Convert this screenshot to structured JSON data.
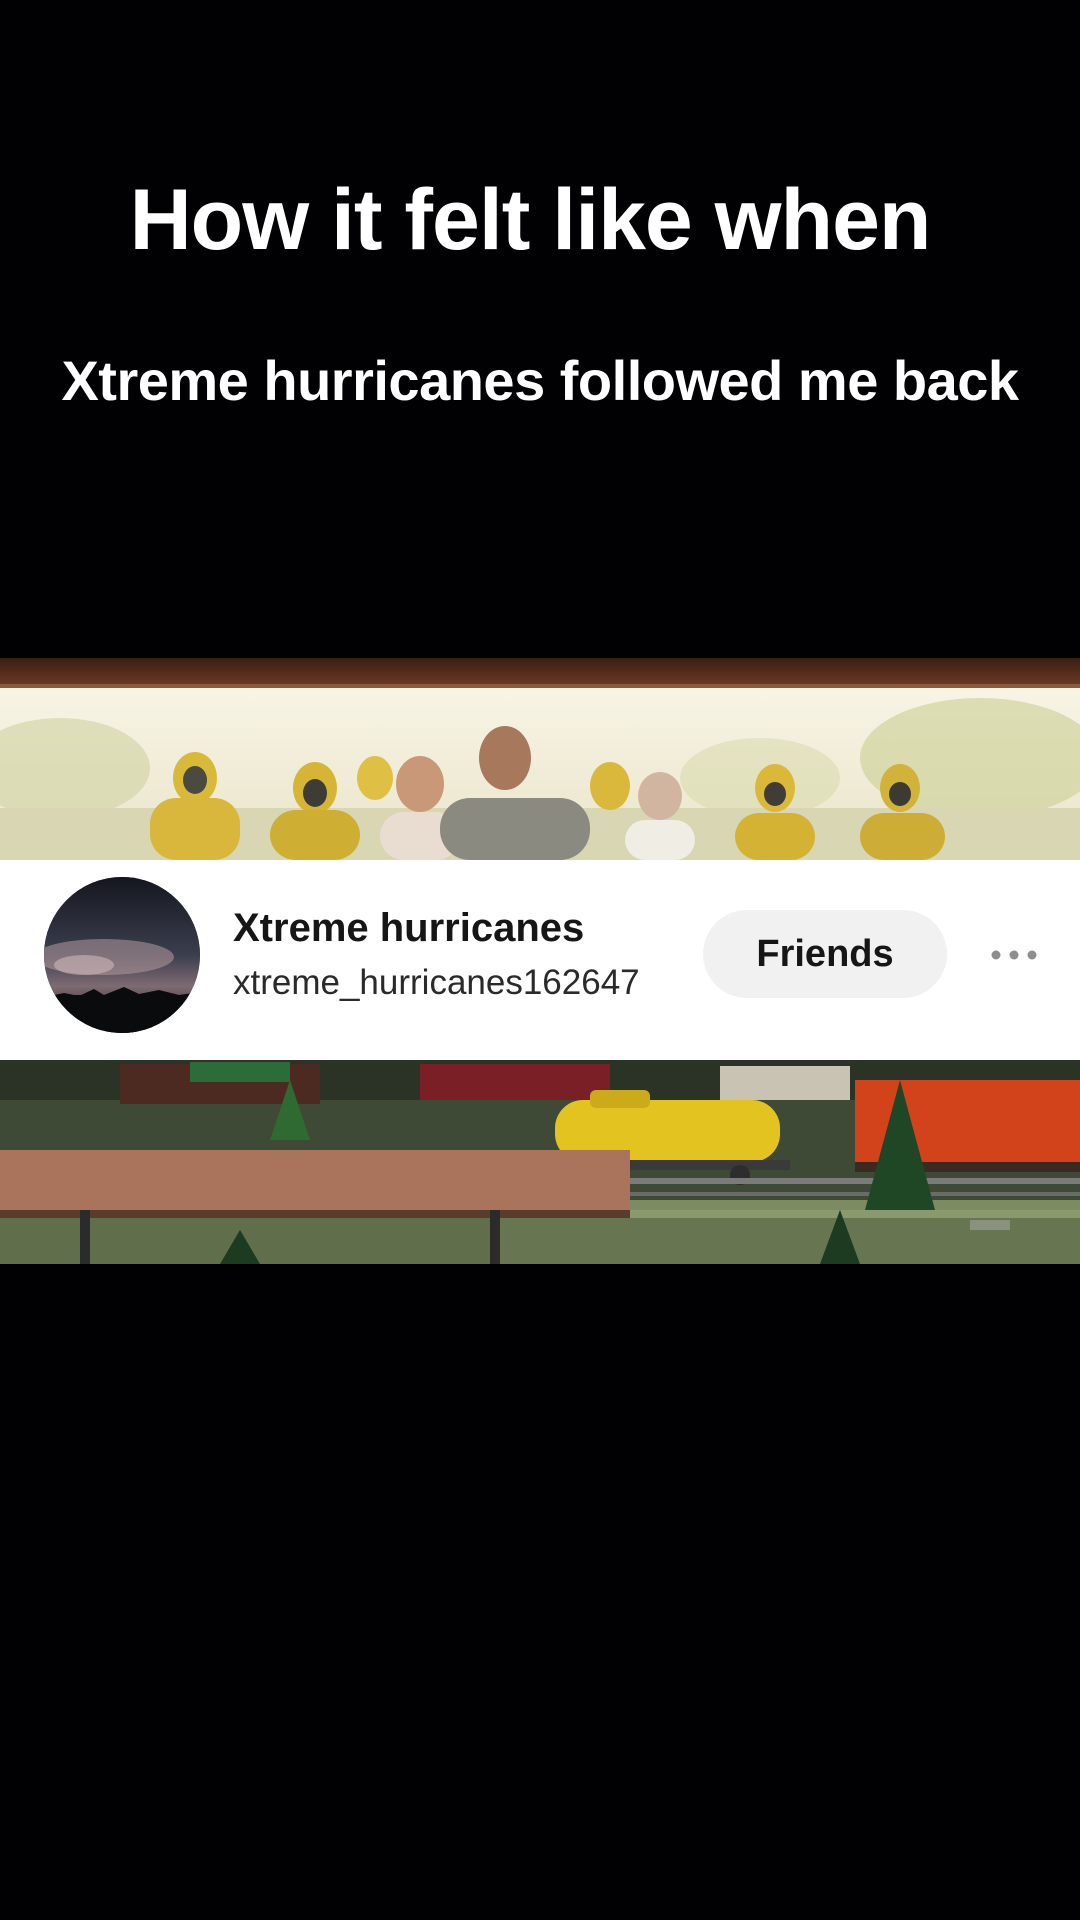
{
  "caption": {
    "title": "How it felt like when",
    "subtitle": "Xtreme hurricanes followed me back"
  },
  "profile": {
    "display_name": "Xtreme hurricanes",
    "username": "xtreme_hurricanes162647",
    "follow_state_label": "Friends",
    "more_icon": "more-horizontal-icon",
    "avatar": "storm-cloud-avatar"
  },
  "colors": {
    "background": "#010103",
    "card": "#ffffff",
    "button_bg": "#f1f1f2",
    "text_primary": "#161616"
  }
}
